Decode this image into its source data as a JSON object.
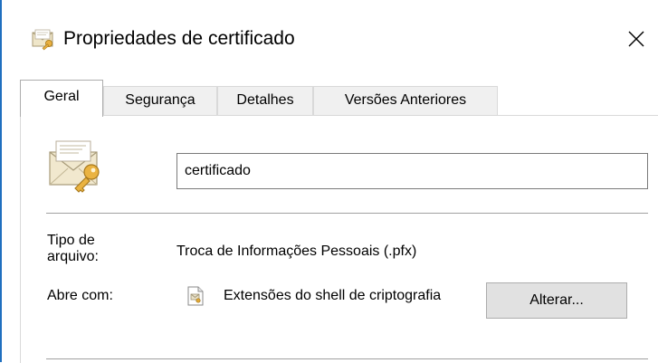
{
  "window": {
    "title": "Propriedades de certificado",
    "title_icon": "certificate-properties-icon",
    "close_icon": "close-icon"
  },
  "tabs": [
    {
      "label": "Geral",
      "active": true
    },
    {
      "label": "Segurança",
      "active": false
    },
    {
      "label": "Detalhes",
      "active": false
    },
    {
      "label": "Versões Anteriores",
      "active": false
    }
  ],
  "general": {
    "file_icon": "certificate-file-icon",
    "file_name": "certificado",
    "file_type_label": "Tipo de arquivo:",
    "file_type_value": "Troca de Informações Pessoais (.pfx)",
    "opens_with_label": "Abre com:",
    "opens_with_icon": "crypto-shell-extension-icon",
    "opens_with_value": "Extensões do shell de criptografia",
    "change_button": "Alterar..."
  },
  "colors": {
    "accent": "#1f6fbf",
    "envelope": "#f3ead0",
    "key": "#e7a92b"
  }
}
